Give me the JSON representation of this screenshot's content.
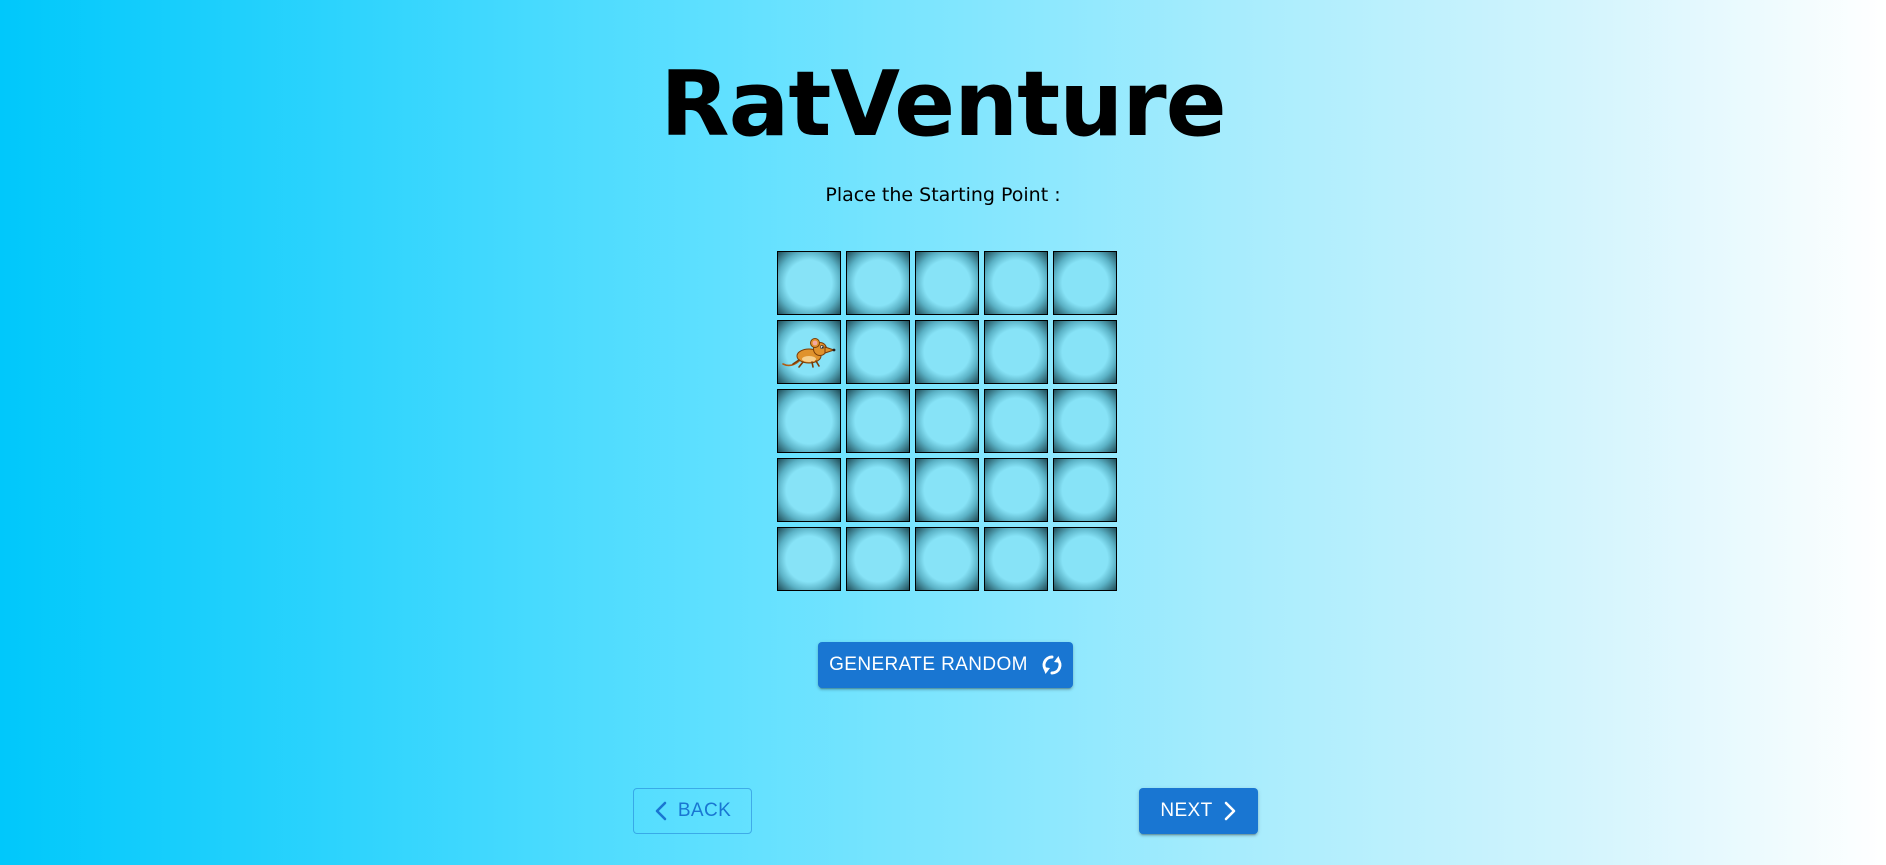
{
  "app": {
    "title": "RatVenture",
    "instruction": "Place the Starting Point :"
  },
  "grid": {
    "rows": 5,
    "columns": 5,
    "start_position": {
      "row": 2,
      "column": 1
    },
    "start_icon": "rat-icon"
  },
  "buttons": {
    "generate_label": "GENERATE RANDOM",
    "generate_icon": "refresh-icon",
    "back_label": "BACK",
    "back_icon": "chevron-left-icon",
    "next_label": "NEXT",
    "next_icon": "chevron-right-icon"
  },
  "colors": {
    "accent": "#1976d2",
    "cell_fill": "#87e3f7",
    "background_start": "#00c8fb",
    "background_end": "#ffffff"
  }
}
